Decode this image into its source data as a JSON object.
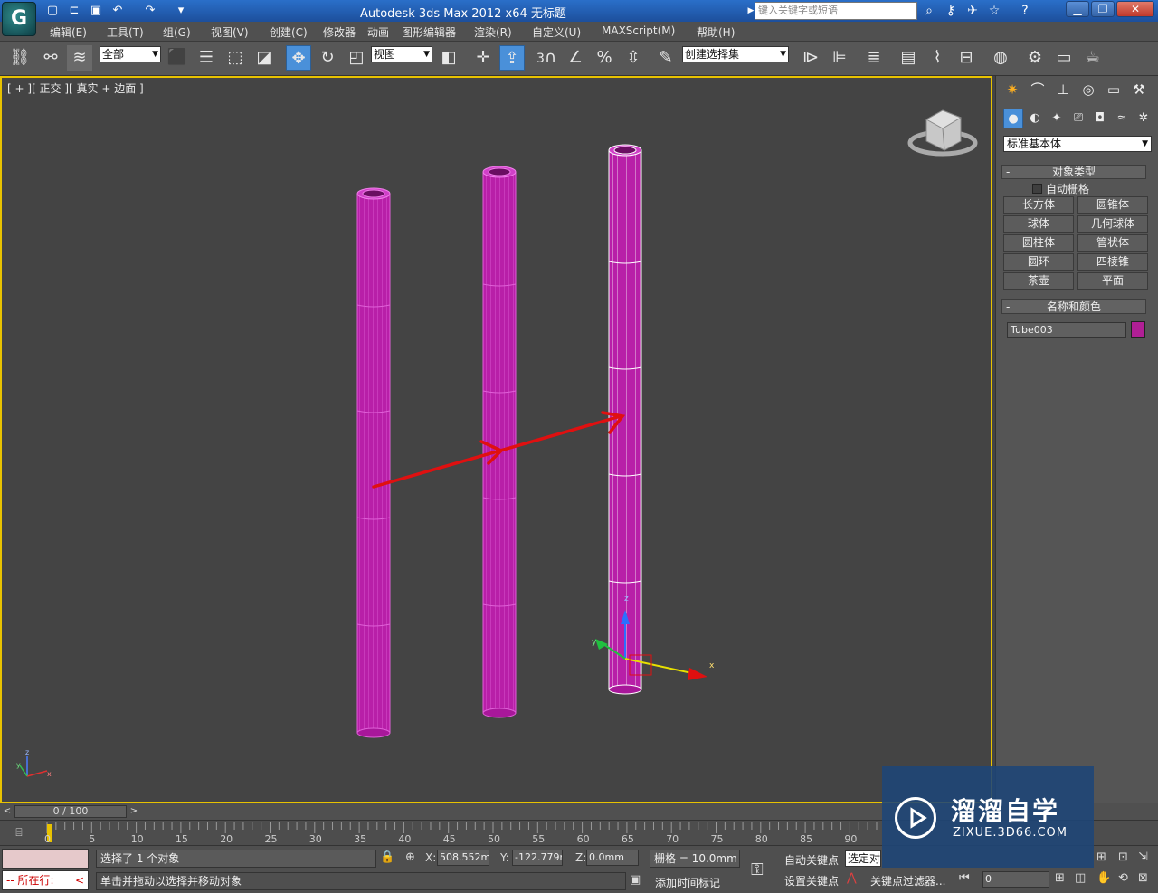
{
  "titlebar": {
    "title": "Autodesk 3ds Max  2012 x64      无标题",
    "search_placeholder": "键入关键字或短语"
  },
  "menu": {
    "items": [
      "编辑(E)",
      "工具(T)",
      "组(G)",
      "视图(V)",
      "创建(C)",
      "修改器",
      "动画",
      "图形编辑器",
      "渲染(R)",
      "自定义(U)",
      "MAXScript(M)",
      "帮助(H)"
    ]
  },
  "toolbar": {
    "selection_filter": "全部",
    "reference_coord": "视图",
    "snap_angle_label": "3",
    "named_selection_placeholder": "创建选择集"
  },
  "viewport": {
    "label": "[ + ][ 正交 ][ 真实 + 边面 ]",
    "axis_x": "x",
    "axis_y": "y",
    "axis_z": "z",
    "object_color": "#c020b0",
    "selected_color": "#ffffff",
    "arrow_color": "#e01010"
  },
  "command_panel": {
    "category": "标准基本体",
    "object_type": {
      "title": "对象类型",
      "autogrid_label": "自动栅格",
      "buttons": [
        "长方体",
        "圆锥体",
        "球体",
        "几何球体",
        "圆柱体",
        "管状体",
        "圆环",
        "四棱锥",
        "茶壶",
        "平面"
      ]
    },
    "name_color": {
      "title": "名称和颜色",
      "name": "Tube003",
      "color": "#b01f95"
    }
  },
  "timeline": {
    "frame_display": "0 / 100",
    "prev": "<",
    "next": ">",
    "ticks": [
      "0",
      "5",
      "10",
      "15",
      "20",
      "25",
      "30",
      "35",
      "40",
      "45",
      "50",
      "55",
      "60",
      "65",
      "70",
      "75",
      "80",
      "85",
      "90"
    ]
  },
  "status": {
    "running_label": "--  所在行:",
    "selection_info": "选择了 1 个对象",
    "prompt": "单击并拖动以选择并移动对象",
    "x_label": "X:",
    "x_value": "508.552mr",
    "y_label": "Y:",
    "y_value": "-122.779m",
    "z_label": "Z:",
    "z_value": "0.0mm",
    "grid": "栅格 = 10.0mm",
    "add_time_tag": "添加时间标记",
    "auto_key": "自动关键点",
    "set_key": "设置关键点",
    "selected_filter": "选定对",
    "key_filters": "关键点过滤器...",
    "current_frame": "0"
  },
  "watermark": {
    "title": "溜溜自学",
    "url": "ZIXUE.3D66.COM"
  }
}
